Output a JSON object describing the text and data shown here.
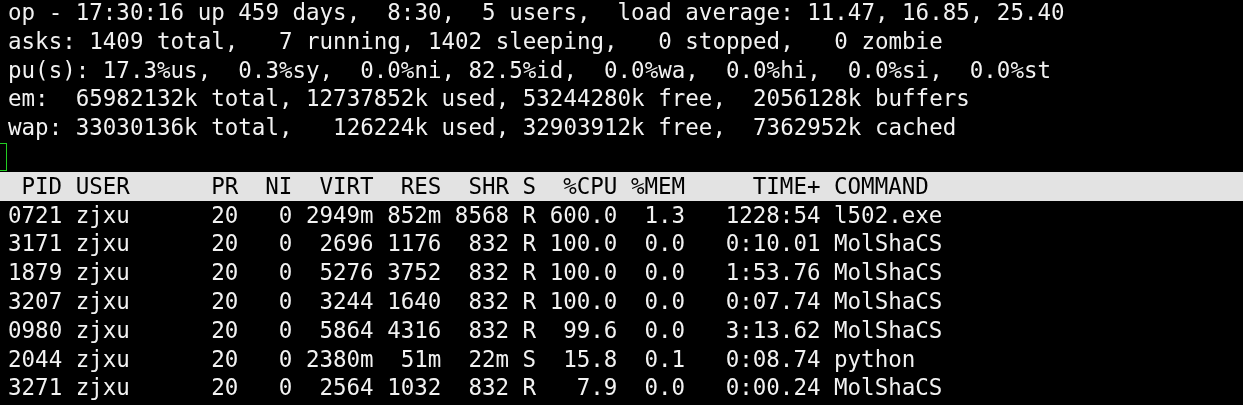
{
  "summary": [
    "op - 17:30:16 up 459 days,  8:30,  5 users,  load average: 11.47, 16.85, 25.40",
    "asks: 1409 total,   7 running, 1402 sleeping,   0 stopped,   0 zombie",
    "pu(s): 17.3%us,  0.3%sy,  0.0%ni, 82.5%id,  0.0%wa,  0.0%hi,  0.0%si,  0.0%st",
    "em:  65982132k total, 12737852k used, 53244280k free,  2056128k buffers",
    "wap: 33030136k total,   126224k used, 32903912k free,  7362952k cached"
  ],
  "table": {
    "columns": [
      "PID",
      "USER",
      "PR",
      "NI",
      "VIRT",
      "RES",
      "SHR",
      "S",
      "%CPU",
      "%MEM",
      "TIME+",
      "COMMAND"
    ],
    "rows": [
      [
        "0721",
        "zjxu",
        "20",
        "0",
        "2949m",
        "852m",
        "8568",
        "R",
        "600.0",
        "1.3",
        "1228:54",
        "l502.exe"
      ],
      [
        "3171",
        "zjxu",
        "20",
        "0",
        "2696",
        "1176",
        "832",
        "R",
        "100.0",
        "0.0",
        "0:10.01",
        "MolShaCS"
      ],
      [
        "1879",
        "zjxu",
        "20",
        "0",
        "5276",
        "3752",
        "832",
        "R",
        "100.0",
        "0.0",
        "1:53.76",
        "MolShaCS"
      ],
      [
        "3207",
        "zjxu",
        "20",
        "0",
        "3244",
        "1640",
        "832",
        "R",
        "100.0",
        "0.0",
        "0:07.74",
        "MolShaCS"
      ],
      [
        "0980",
        "zjxu",
        "20",
        "0",
        "5864",
        "4316",
        "832",
        "R",
        "99.6",
        "0.0",
        "3:13.62",
        "MolShaCS"
      ],
      [
        "2044",
        "zjxu",
        "20",
        "0",
        "2380m",
        "51m",
        "22m",
        "S",
        "15.8",
        "0.1",
        "0:08.74",
        "python"
      ],
      [
        "3271",
        "zjxu",
        "20",
        "0",
        "2564",
        "1032",
        "832",
        "R",
        "7.9",
        "0.0",
        "0:00.24",
        "MolShaCS"
      ]
    ]
  }
}
